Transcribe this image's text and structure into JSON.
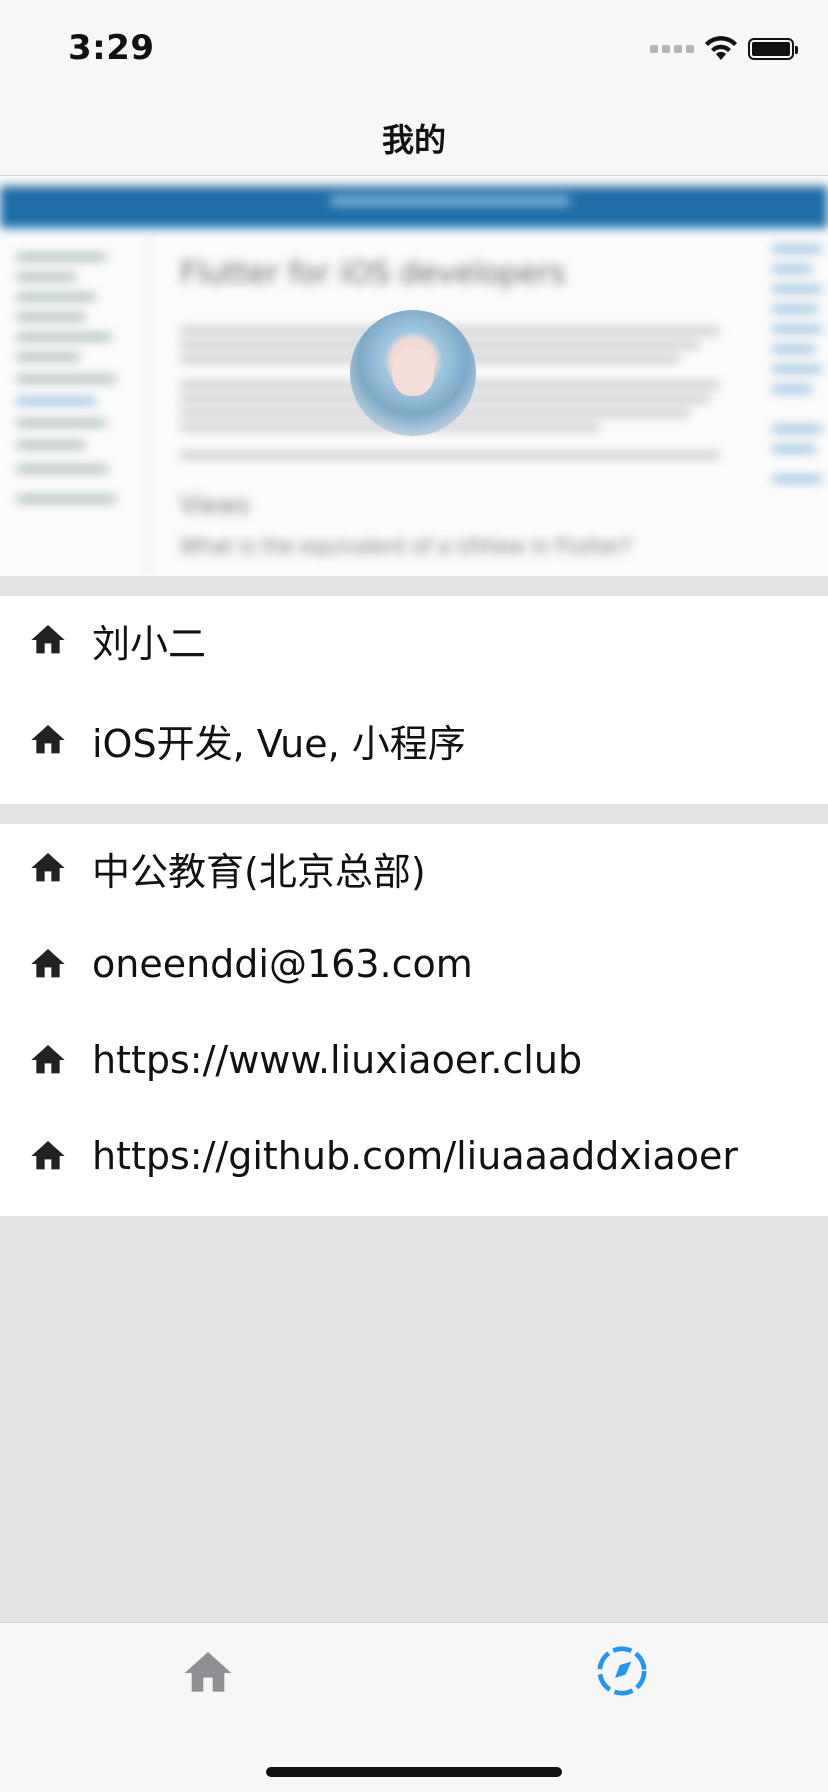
{
  "status_bar": {
    "time": "3:29"
  },
  "nav": {
    "title": "我的"
  },
  "header": {
    "blurred_title": "Flutter for iOS developers",
    "blurred_section": "Views",
    "blurred_question": "What is the equivalent of a UIView in Flutter?"
  },
  "profile_section": {
    "items": [
      {
        "icon": "home-icon",
        "label": "刘小二"
      },
      {
        "icon": "home-icon",
        "label": "iOS开发, Vue, 小程序"
      }
    ]
  },
  "contact_section": {
    "items": [
      {
        "icon": "home-icon",
        "label": "中公教育(北京总部)"
      },
      {
        "icon": "home-icon",
        "label": "oneenddi@163.com"
      },
      {
        "icon": "home-icon",
        "label": "https://www.liuxiaoer.club"
      },
      {
        "icon": "home-icon",
        "label": "https://github.com/liuaaaddxiaoer"
      }
    ]
  },
  "tab_bar": {
    "tabs": [
      {
        "icon": "home-icon",
        "active": false
      },
      {
        "icon": "compass-icon",
        "active": true
      }
    ],
    "active_color": "#2196f3",
    "inactive_color": "#8e8e93"
  }
}
